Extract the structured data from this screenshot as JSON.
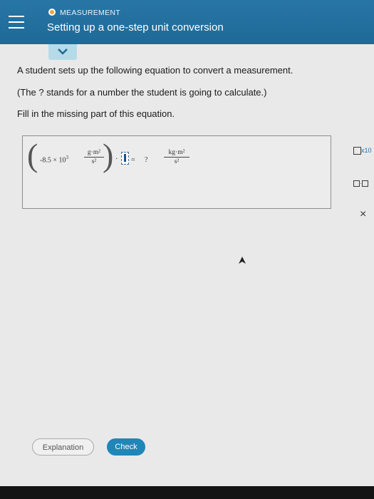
{
  "header": {
    "section": "MEASUREMENT",
    "title": "Setting up a one-step unit conversion",
    "accent_color": "#1f6f9e",
    "status_color": "#f2a23a"
  },
  "question": {
    "line1": "A student sets up the following equation to convert a measurement.",
    "line2": "(The ? stands for a number the student is going to calculate.)",
    "line3": "Fill in the missing part of this equation."
  },
  "equation": {
    "coefficient": "-8.5 × 10",
    "exponent": "3",
    "left_unit_num": "g·m²",
    "left_unit_den": "s²",
    "dot": "·",
    "equals": "=",
    "unknown": "?",
    "right_unit_num": "kg·m²",
    "right_unit_den": "s²"
  },
  "tools": {
    "x10_label": "x10",
    "dot_label": "·",
    "clear_label": "×"
  },
  "buttons": {
    "explanation": "Explanation",
    "check": "Check"
  }
}
